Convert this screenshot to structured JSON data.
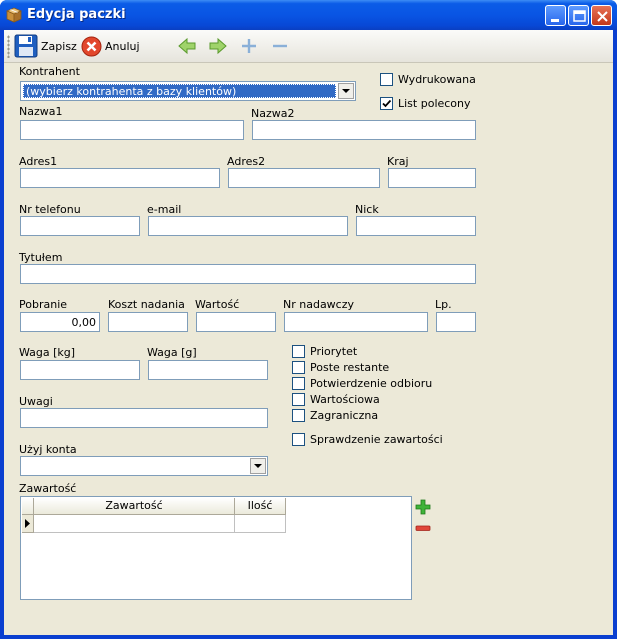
{
  "window": {
    "title": "Edycja paczki",
    "icon": "package-icon"
  },
  "toolbar": {
    "save_label": "Zapisz",
    "cancel_label": "Anuluj"
  },
  "form": {
    "kontrahent_label": "Kontrahent",
    "kontrahent_value": "(wybierz kontrahenta z bazy klientów)",
    "wydrukowana_label": "Wydrukowana",
    "wydrukowana_checked": false,
    "list_polecony_label": "List polecony",
    "list_polecony_checked": true,
    "nazwa1_label": "Nazwa1",
    "nazwa1_value": "",
    "nazwa2_label": "Nazwa2",
    "nazwa2_value": "",
    "adres1_label": "Adres1",
    "adres2_label": "Adres2",
    "kraj_label": "Kraj",
    "telefon_label": "Nr telefonu",
    "email_label": "e-mail",
    "nick_label": "Nick",
    "tytulem_label": "Tytułem",
    "pobranie_label": "Pobranie",
    "pobranie_value": "0,00",
    "koszt_label": "Koszt nadania",
    "wartosc_label": "Wartość",
    "nr_nadawczy_label": "Nr nadawczy",
    "lp_label": "Lp.",
    "waga_kg_label": "Waga [kg]",
    "waga_g_label": "Waga [g]",
    "uwagi_label": "Uwagi",
    "uzyj_konta_label": "Użyj konta",
    "uzyj_konta_value": "",
    "zawartosc_label": "Zawartość"
  },
  "options": [
    {
      "label": "Priorytet",
      "checked": false
    },
    {
      "label": "Poste restante",
      "checked": false
    },
    {
      "label": "Potwierdzenie odbioru",
      "checked": false
    },
    {
      "label": "Wartościowa",
      "checked": false
    },
    {
      "label": "Zagraniczna",
      "checked": false
    },
    {
      "label": "Sprawdzenie zawartości",
      "checked": false
    }
  ],
  "grid": {
    "columns": [
      "Zawartość",
      "Ilość"
    ]
  },
  "colors": {
    "titlebar": "#0955e4",
    "selection": "#316ac5",
    "panel": "#ece9d8"
  }
}
